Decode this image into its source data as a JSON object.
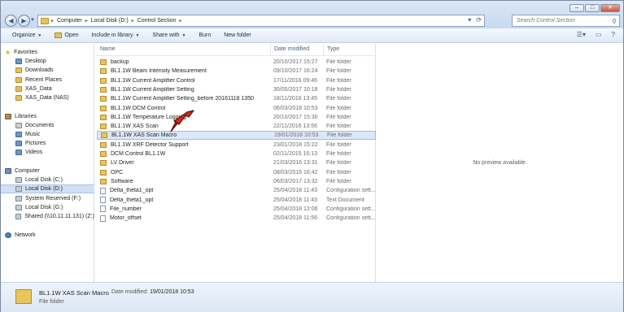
{
  "address": {
    "crumbs": [
      "Computer",
      "Local Disk (D:)",
      "Control Section"
    ],
    "search_placeholder": "Search Control Section"
  },
  "toolbar": {
    "organize": "Organize",
    "open": "Open",
    "include_in_library": "Include in library",
    "share_with": "Share with",
    "burn": "Burn",
    "new_folder": "New folder"
  },
  "nav": {
    "favorites": "Favorites",
    "desktop": "Desktop",
    "downloads": "Downloads",
    "recent_places": "Recent Places",
    "xas_data": "XAS_Data",
    "xas_data_nas": "XAS_Data (NAS)",
    "libraries": "Libraries",
    "documents": "Documents",
    "music": "Music",
    "pictures": "Pictures",
    "videos": "Videos",
    "computer": "Computer",
    "local_c": "Local Disk (C:)",
    "local_d": "Local Disk (D:)",
    "system_reserved": "System Reserved (F:)",
    "local_g": "Local Disk (G:)",
    "shared_z": "Shared (\\\\10.11.11.131) (Z:)",
    "network": "Network"
  },
  "columns": {
    "name": "Name",
    "date": "Date modified",
    "type": "Type"
  },
  "files": [
    {
      "name": "backup",
      "date": "20/10/2017 15:27",
      "type": "File folder"
    },
    {
      "name": "BL1.1W Beam Intensity Measurement",
      "date": "09/10/2017 16:24",
      "type": "File folder"
    },
    {
      "name": "BL1.1W Current Amplifier Control",
      "date": "17/11/2016 09:46",
      "type": "File folder"
    },
    {
      "name": "BL1.1W Current Amplifier Setting",
      "date": "30/05/2017 10:18",
      "type": "File folder"
    },
    {
      "name": "BL1.1W Current Amplifier Setting_before 20161118 1350",
      "date": "18/11/2016 13:45",
      "type": "File folder"
    },
    {
      "name": "BL1.1W DCM Control",
      "date": "06/03/2018 10:53",
      "type": "File folder"
    },
    {
      "name": "BL1.1W Temperature Logging",
      "date": "20/10/2017 15:30",
      "type": "File folder"
    },
    {
      "name": "BL1.1W XAS Scan",
      "date": "22/11/2016 13:56",
      "type": "File folder"
    },
    {
      "name": "BL1.1W XAS Scan Macro",
      "date": "19/01/2018 10:53",
      "type": "File folder"
    },
    {
      "name": "BL1.1W XRF Detector Support",
      "date": "23/01/2018 15:22",
      "type": "File folder"
    },
    {
      "name": "DCM Control BL1.1W",
      "date": "02/11/2015 16:13",
      "type": "File folder"
    },
    {
      "name": "LV Driver",
      "date": "21/03/2016 13:31",
      "type": "File folder"
    },
    {
      "name": "OPC",
      "date": "08/03/2016 16:42",
      "type": "File folder"
    },
    {
      "name": "Software",
      "date": "06/03/2017 13:32",
      "type": "File folder"
    },
    {
      "name": "Delta_theta1_opt",
      "date": "25/04/2018 11:43",
      "type": "Configuration sett..."
    },
    {
      "name": "Delta_theta1_opt",
      "date": "25/04/2018 11:43",
      "type": "Text Document"
    },
    {
      "name": "File_number",
      "date": "25/04/2018 12:06",
      "type": "Configuration sett..."
    },
    {
      "name": "Motor_offset",
      "date": "25/04/2018 11:56",
      "type": "Configuration sett..."
    }
  ],
  "preview": {
    "empty_text": "No preview available."
  },
  "details": {
    "name": "BL1.1W XAS Scan Macro",
    "modified_label": "Date modified:",
    "modified_value": "19/01/2018 10:53",
    "type": "File folder"
  },
  "colors": {
    "selection": "#dbe8f8",
    "arrow": "#d9261c"
  }
}
